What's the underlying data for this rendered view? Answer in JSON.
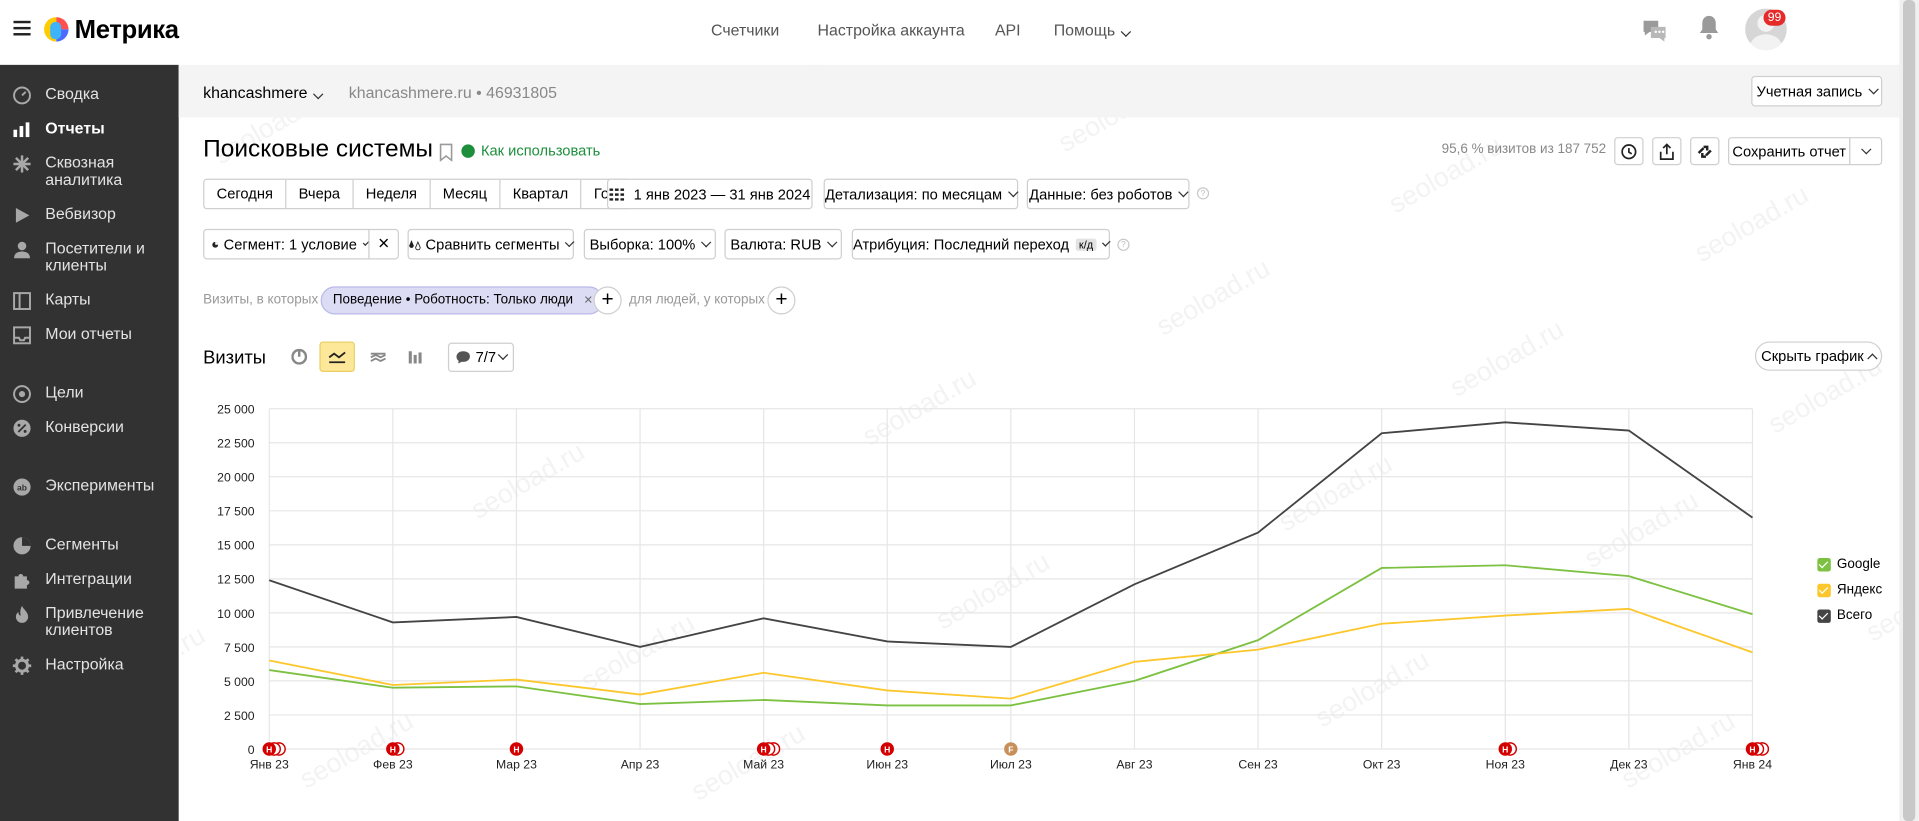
{
  "app": {
    "name": "Метрика"
  },
  "topnav": [
    "Счетчики",
    "Настройка аккаунта",
    "API",
    "Помощь"
  ],
  "notifications_count": "99",
  "sidebar": {
    "items": [
      {
        "label": "Сводка",
        "icon": "dashboard-icon"
      },
      {
        "label": "Отчеты",
        "icon": "bar-chart-icon",
        "active": true
      },
      {
        "label": "Сквозная аналитика",
        "icon": "analytics-icon"
      },
      {
        "label": "Вебвизор",
        "icon": "play-icon"
      },
      {
        "label": "Посетители и клиенты",
        "icon": "user-icon"
      },
      {
        "label": "Карты",
        "icon": "map-icon"
      },
      {
        "label": "Мои отчеты",
        "icon": "inbox-icon"
      },
      {
        "label": "Цели",
        "icon": "target-icon"
      },
      {
        "label": "Конверсии",
        "icon": "percent-icon"
      },
      {
        "label": "Эксперименты",
        "icon": "ab-icon"
      },
      {
        "label": "Сегменты",
        "icon": "pie-icon"
      },
      {
        "label": "Интеграции",
        "icon": "puzzle-icon"
      },
      {
        "label": "Привлечение клиентов",
        "icon": "flame-icon"
      },
      {
        "label": "Настройка",
        "icon": "gear-icon"
      }
    ]
  },
  "account": {
    "name": "khancashmere",
    "site": "khancashmere.ru",
    "counter": "46931805",
    "account_button": "Учетная запись"
  },
  "report": {
    "title": "Поисковые системы",
    "howto": "Как использовать",
    "stats": "95,6 % визитов из 187 752",
    "save_button": "Сохранить отчет"
  },
  "periods": [
    "Сегодня",
    "Вчера",
    "Неделя",
    "Месяц",
    "Квартал",
    "Год"
  ],
  "date_range": "1 янв 2023 — 31 янв 2024",
  "detail": "Детализация: по месяцам",
  "data_filter": "Данные: без роботов",
  "segment": "Сегмент: 1 условие",
  "compare": "Сравнить сегменты",
  "sample": "Выборка: 100%",
  "currency": "Валюта: RUB",
  "attribution": "Атрибуция: Последний переход",
  "attribution_badge": "к/д",
  "filter": {
    "prefix": "Визиты, в которых",
    "chip": "Поведение • Роботность: Только люди",
    "people": "для людей, у которых"
  },
  "chart_section": {
    "title": "Визиты",
    "series_count": "7/7",
    "hide_button": "Скрыть график"
  },
  "colors": {
    "google": "#7cc142",
    "yandex": "#fcc72c",
    "total": "#444444",
    "accent": "#fde89a"
  },
  "chart_data": {
    "type": "line",
    "categories": [
      "Янв 23",
      "Фев 23",
      "Мар 23",
      "Апр 23",
      "Май 23",
      "Июн 23",
      "Июл 23",
      "Авг 23",
      "Сен 23",
      "Окт 23",
      "Ноя 23",
      "Дек 23",
      "Янв 24"
    ],
    "yticks": [
      "0",
      "2 500",
      "5 000",
      "7 500",
      "10 000",
      "12 500",
      "15 000",
      "17 500",
      "20 000",
      "22 500",
      "25 000"
    ],
    "ylim": [
      0,
      25000
    ],
    "series": [
      {
        "name": "Google",
        "color": "#7cc142",
        "values": [
          5800,
          4500,
          4600,
          3300,
          3600,
          3200,
          3200,
          5000,
          8000,
          13300,
          13500,
          12700,
          9900
        ]
      },
      {
        "name": "Яндекс",
        "color": "#fcc72c",
        "values": [
          6500,
          4700,
          5100,
          4000,
          5600,
          4300,
          3700,
          6400,
          7300,
          9200,
          9800,
          10300,
          7100
        ]
      },
      {
        "name": "Всего",
        "color": "#444444",
        "values": [
          12400,
          9300,
          9700,
          7500,
          9600,
          7900,
          7500,
          12100,
          15900,
          23200,
          24000,
          23400,
          17000
        ]
      }
    ],
    "legend": "right",
    "grid": true,
    "annotations": [
      {
        "x": "Янв 23",
        "label": "Н",
        "count": 3
      },
      {
        "x": "Фев 23",
        "label": "Н",
        "count": 2
      },
      {
        "x": "Мар 23",
        "label": "Н",
        "count": 1
      },
      {
        "x": "Май 23",
        "label": "Н",
        "count": 3
      },
      {
        "x": "Июн 23",
        "label": "Н",
        "count": 1
      },
      {
        "x": "Июл 23",
        "label": "F",
        "count": 1
      },
      {
        "x": "Ноя 23",
        "label": "Н",
        "count": 2
      },
      {
        "x": "Янв 24",
        "label": "Н",
        "count": 3
      }
    ]
  },
  "watermark": "seoload.ru"
}
